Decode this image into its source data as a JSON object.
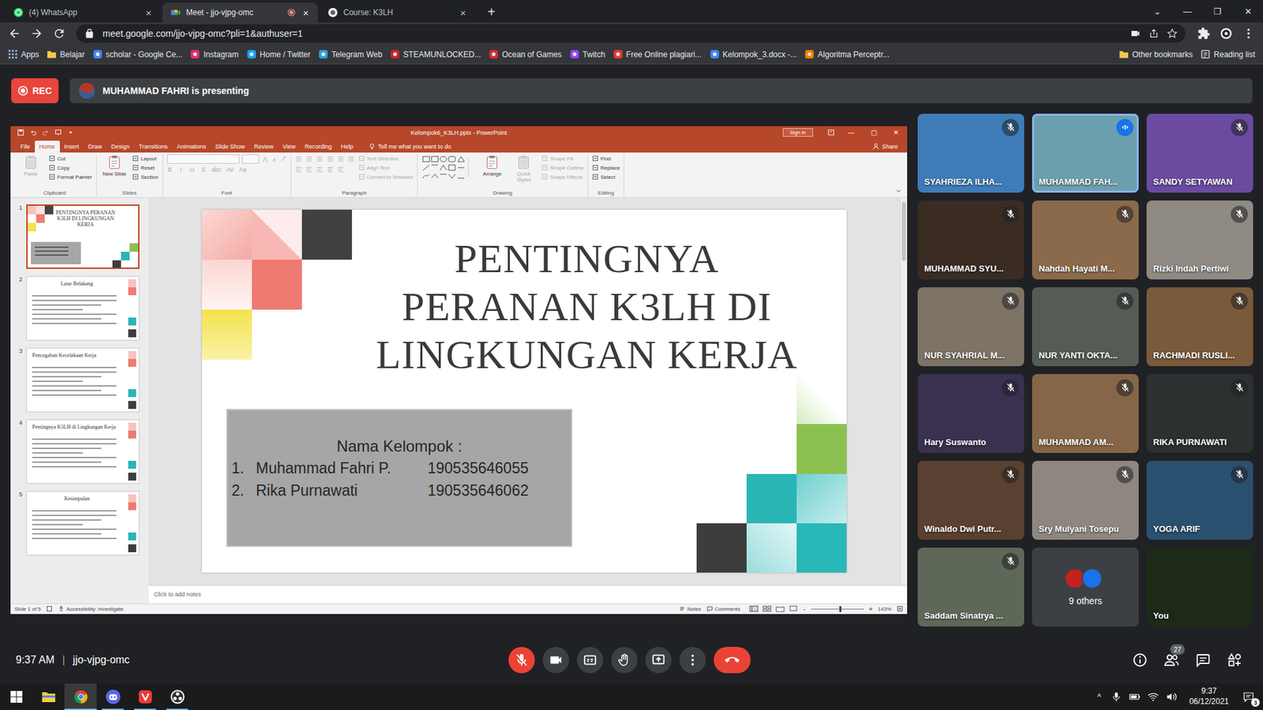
{
  "browser": {
    "tabs": [
      {
        "label": "(4) WhatsApp",
        "kind": "whatsapp",
        "selected": false,
        "recording": false,
        "close": "×"
      },
      {
        "label": "Meet - jjo-vjpg-omc",
        "kind": "meet",
        "selected": true,
        "recording": true,
        "close": "×"
      },
      {
        "label": "Course: K3LH",
        "kind": "course",
        "selected": false,
        "recording": false,
        "close": "×"
      }
    ],
    "new_tab": "+",
    "window_controls": [
      "⌄",
      "—",
      "❐",
      "✕"
    ],
    "url": "meet.google.com/jjo-vjpg-omc?pli=1&authuser=1",
    "bookmarks": [
      {
        "label": "Apps",
        "kind": "apps",
        "color": "#8ab4f8"
      },
      {
        "label": "Belajar",
        "kind": "folder",
        "color": "#f2c94c"
      },
      {
        "label": "scholar - Google Ce...",
        "kind": "site",
        "color": "#4285f4"
      },
      {
        "label": "Instagram",
        "kind": "site",
        "color": "#e1306c"
      },
      {
        "label": "Home / Twitter",
        "kind": "site",
        "color": "#1da1f2"
      },
      {
        "label": "Telegram Web",
        "kind": "site",
        "color": "#2aa3df"
      },
      {
        "label": "STEAMUNLOCKED...",
        "kind": "site",
        "color": "#c62828"
      },
      {
        "label": "Ocean of Games",
        "kind": "site",
        "color": "#d32f2f"
      },
      {
        "label": "Twitch",
        "kind": "site",
        "color": "#9146ff"
      },
      {
        "label": "Free Online plagiari...",
        "kind": "site",
        "color": "#e53935"
      },
      {
        "label": "Kelompok_3.docx -...",
        "kind": "site",
        "color": "#4285f4"
      },
      {
        "label": "Algoritma Perceptr...",
        "kind": "site",
        "color": "#f57c00"
      }
    ],
    "bookmarks_right": [
      {
        "label": "Other bookmarks",
        "kind": "folder",
        "color": "#f2c94c"
      },
      {
        "label": "Reading list",
        "kind": "reading",
        "color": "#e8eaed"
      }
    ]
  },
  "meet": {
    "rec": "REC",
    "presenter": "MUHAMMAD FAHRI is presenting",
    "time": "9:37 AM",
    "separator": "|",
    "code": "jjo-vjpg-omc",
    "controls": [
      {
        "kind": "mic",
        "on": false
      },
      {
        "kind": "camera",
        "on": true
      },
      {
        "kind": "captions",
        "on": false
      },
      {
        "kind": "hand",
        "on": false
      },
      {
        "kind": "present",
        "on": false
      },
      {
        "kind": "more",
        "on": false
      },
      {
        "kind": "end",
        "on": false
      }
    ],
    "side_buttons": [
      {
        "kind": "info",
        "badge": ""
      },
      {
        "kind": "people",
        "badge": "27"
      },
      {
        "kind": "chat",
        "badge": ""
      },
      {
        "kind": "activities",
        "badge": ""
      }
    ],
    "tiles": [
      {
        "name": "SYAHRIEZA ILHA...",
        "kind": "video",
        "muted": true,
        "speaking": false,
        "color": "#3f7cb8"
      },
      {
        "name": "MUHAMMAD FAH...",
        "kind": "video",
        "muted": false,
        "speaking": true,
        "color": "#6c9fae"
      },
      {
        "name": "SANDY SETYAWAN",
        "kind": "video",
        "muted": true,
        "speaking": false,
        "color": "#6a4ba0"
      },
      {
        "name": "MUHAMMAD SYU...",
        "kind": "video",
        "muted": true,
        "speaking": false,
        "color": "#3a2c22"
      },
      {
        "name": "Nahdah Hayati M...",
        "kind": "video",
        "muted": true,
        "speaking": false,
        "color": "#8a6a4a"
      },
      {
        "name": "Rizki Indah Pertiwi",
        "kind": "video",
        "muted": true,
        "speaking": false,
        "color": "#8f8a84"
      },
      {
        "name": "NUR SYAHRIAL M...",
        "kind": "video",
        "muted": true,
        "speaking": false,
        "color": "#7d7466"
      },
      {
        "name": "NUR YANTI OKTA...",
        "kind": "video",
        "muted": true,
        "speaking": false,
        "color": "#565c55"
      },
      {
        "name": "RACHMADI RUSLI...",
        "kind": "video",
        "muted": true,
        "speaking": false,
        "color": "#7a5a3a"
      },
      {
        "name": "Hary Suswanto",
        "kind": "video",
        "muted": true,
        "speaking": false,
        "color": "#3a3050"
      },
      {
        "name": "MUHAMMAD AM...",
        "kind": "video",
        "muted": true,
        "speaking": false,
        "color": "#866648"
      },
      {
        "name": "RIKA PURNAWATI",
        "kind": "video",
        "muted": true,
        "speaking": false,
        "color": "#2c3030"
      },
      {
        "name": "Winaldo Dwi Putr...",
        "kind": "video",
        "muted": true,
        "speaking": false,
        "color": "#5a4030"
      },
      {
        "name": "Sry Mulyani Tosepu",
        "kind": "video",
        "muted": true,
        "speaking": false,
        "color": "#8e8780"
      },
      {
        "name": "YOGA ARIF",
        "kind": "video",
        "muted": true,
        "speaking": false,
        "color": "#2a5070"
      },
      {
        "name": "Saddam Sinatrya ...",
        "kind": "video",
        "muted": true,
        "speaking": false,
        "color": "#5e6858"
      },
      {
        "name": "9 others",
        "kind": "others",
        "muted": false,
        "speaking": false,
        "color": "#3c4043"
      },
      {
        "name": "You",
        "kind": "video",
        "muted": false,
        "speaking": false,
        "color": "#1e2a18"
      }
    ],
    "others_avatars": [
      "#c5221f",
      "#1a73e8"
    ]
  },
  "powerpoint": {
    "title": "Kelompok6_K3LH.pptx - PowerPoint",
    "sign_in": "Sign in",
    "window_controls": [
      "—",
      "▢",
      "✕"
    ],
    "tabs": [
      {
        "label": "File",
        "selected": false
      },
      {
        "label": "Home",
        "selected": true
      },
      {
        "label": "Insert",
        "selected": false
      },
      {
        "label": "Draw",
        "selected": false
      },
      {
        "label": "Design",
        "selected": false
      },
      {
        "label": "Transitions",
        "selected": false
      },
      {
        "label": "Animations",
        "selected": false
      },
      {
        "label": "Slide Show",
        "selected": false
      },
      {
        "label": "Review",
        "selected": false
      },
      {
        "label": "View",
        "selected": false
      },
      {
        "label": "Recording",
        "selected": false
      },
      {
        "label": "Help",
        "selected": false
      }
    ],
    "tell_me": "Tell me what you want to do",
    "share": "Share",
    "groups": [
      {
        "label": "Clipboard",
        "kind": "plain",
        "buttons": [
          {
            "label": "Paste",
            "kind": "big",
            "disabled": true
          },
          {
            "label": "Cut",
            "kind": "small",
            "disabled": false
          },
          {
            "label": "Copy",
            "kind": "small",
            "disabled": false
          },
          {
            "label": "Format Painter",
            "kind": "small",
            "disabled": false
          }
        ]
      },
      {
        "label": "Slides",
        "kind": "plain",
        "buttons": [
          {
            "label": "New Slide",
            "kind": "big",
            "disabled": false
          },
          {
            "label": "Layout",
            "kind": "small",
            "disabled": false
          },
          {
            "label": "Reset",
            "kind": "small",
            "disabled": false
          },
          {
            "label": "Section",
            "kind": "small",
            "disabled": false
          }
        ]
      },
      {
        "label": "Font",
        "kind": "font",
        "buttons": [
          {
            "label": "B",
            "kind": "glyph",
            "disabled": true
          },
          {
            "label": "I",
            "kind": "glyph",
            "disabled": true
          },
          {
            "label": "U",
            "kind": "glyph",
            "disabled": true
          },
          {
            "label": "S",
            "kind": "glyph",
            "disabled": true
          },
          {
            "label": "abc",
            "kind": "glyph",
            "disabled": true
          },
          {
            "label": "AV",
            "kind": "glyph",
            "disabled": true
          },
          {
            "label": "Aa",
            "kind": "glyph",
            "disabled": true
          }
        ]
      },
      {
        "label": "Paragraph",
        "kind": "paragraph",
        "buttons": [
          {
            "label": "Text Direction",
            "kind": "small",
            "disabled": true
          },
          {
            "label": "Align Text",
            "kind": "small",
            "disabled": true
          },
          {
            "label": "Convert to SmartArt",
            "kind": "small",
            "disabled": true
          }
        ]
      },
      {
        "label": "Drawing",
        "kind": "drawing",
        "buttons": [
          {
            "label": "Arrange",
            "kind": "big",
            "disabled": false
          },
          {
            "label": "Quick Styles",
            "kind": "big",
            "disabled": true
          },
          {
            "label": "Shape Fill",
            "kind": "small",
            "disabled": true
          },
          {
            "label": "Shape Outline",
            "kind": "small",
            "disabled": true
          },
          {
            "label": "Shape Effects",
            "kind": "small",
            "disabled": true
          }
        ]
      },
      {
        "label": "Editing",
        "kind": "plain",
        "buttons": [
          {
            "label": "Find",
            "kind": "small",
            "disabled": false
          },
          {
            "label": "Replace",
            "kind": "small",
            "disabled": false
          },
          {
            "label": "Select",
            "kind": "small",
            "disabled": false
          }
        ]
      }
    ],
    "thumbnails": [
      {
        "number": "1",
        "title": "PENTINGNYA PERANAN K3LH DI LINGKUNGAN KERJA",
        "kind": "title",
        "centered": true,
        "selected": true
      },
      {
        "number": "2",
        "title": "Latar Belakang",
        "kind": "content",
        "centered": true,
        "selected": false
      },
      {
        "number": "3",
        "title": "Pencegahan Kecelakaan Kerja",
        "kind": "content",
        "centered": false,
        "selected": false
      },
      {
        "number": "4",
        "title": "Pentingnya K3LH di Lingkungan Kerja",
        "kind": "content",
        "centered": false,
        "selected": false
      },
      {
        "number": "5",
        "title": "Kesimpulan",
        "kind": "content",
        "centered": true,
        "selected": false
      }
    ],
    "slide": {
      "title_lines": [
        "PENTINGNYA",
        "PERANAN K3LH DI",
        "LINGKUNGAN KERJA"
      ],
      "group_label": "Nama Kelompok :",
      "members": [
        {
          "number": "1.",
          "name": "Muhammad Fahri P.",
          "id": "190535646055"
        },
        {
          "number": "2.",
          "name": "Rika Purnawati",
          "id": "190535646062"
        }
      ]
    },
    "notes_placeholder": "Click to add notes",
    "status": {
      "slide": "Slide 1 of 5",
      "accessibility": "Accessibility: Investigate",
      "notes": "Notes",
      "comments": "Comments",
      "zoom_minus": "-",
      "zoom_plus": "+",
      "zoom": "143%",
      "zoom_level": 0.55
    }
  },
  "taskbar": {
    "apps": [
      {
        "kind": "start",
        "running": false,
        "selected": false
      },
      {
        "kind": "explorer",
        "running": false,
        "selected": false
      },
      {
        "kind": "chrome",
        "running": true,
        "selected": true
      },
      {
        "kind": "discord",
        "running": true,
        "selected": false
      },
      {
        "kind": "vivaldi",
        "running": true,
        "selected": false
      },
      {
        "kind": "obs",
        "running": true,
        "selected": false
      }
    ],
    "tray_arrow": "^",
    "time": "9:37",
    "date": "06/12/2021",
    "notifications": "3"
  }
}
